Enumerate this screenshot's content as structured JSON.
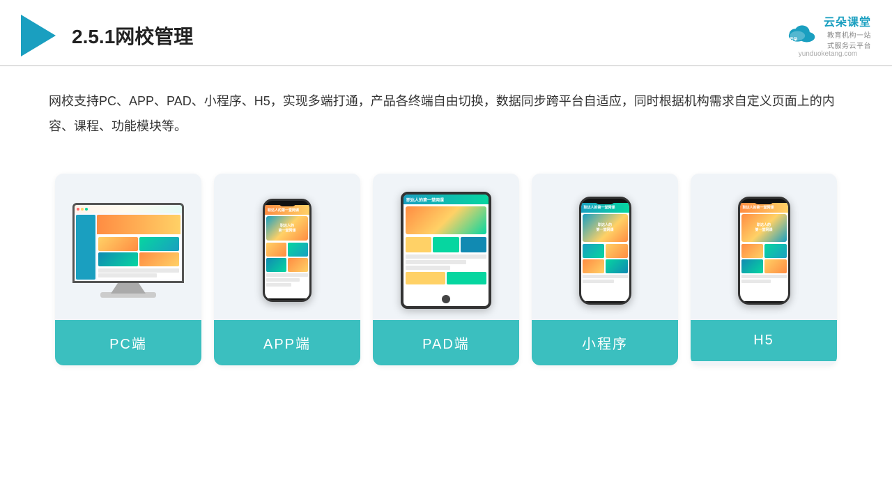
{
  "header": {
    "title": "2.5.1网校管理",
    "brand": {
      "name": "云朵课堂",
      "url": "yunduoketang.com",
      "tagline": "教育机构一站",
      "tagline2": "式服务云平台"
    }
  },
  "description": {
    "text": "网校支持PC、APP、PAD、小程序、H5，实现多端打通，产品各终端自由切换，数据同步跨平台自适应，同时根据机构需求自定义页面上的内容、课程、功能模块等。"
  },
  "cards": [
    {
      "id": "pc",
      "label": "PC端"
    },
    {
      "id": "app",
      "label": "APP端"
    },
    {
      "id": "pad",
      "label": "PAD端"
    },
    {
      "id": "miniapp",
      "label": "小程序"
    },
    {
      "id": "h5",
      "label": "H5"
    }
  ],
  "colors": {
    "teal": "#3bbfbf",
    "accent": "#1a9fc0",
    "bg_card": "#f0f4f8",
    "header_border": "#d0d0d0"
  }
}
